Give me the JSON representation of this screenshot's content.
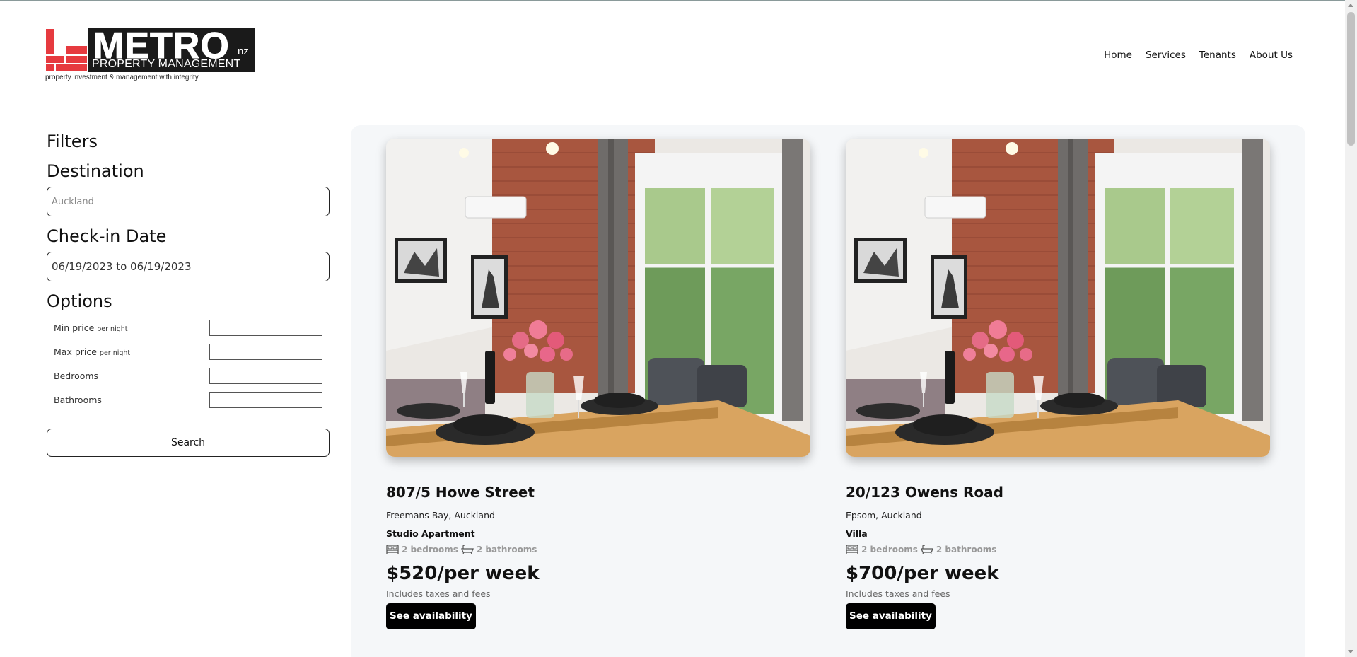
{
  "logo": {
    "brand": "METRO",
    "country": "nz",
    "subtitle": "PROPERTY MANAGEMENT",
    "tagline": "property investment & management with integrity",
    "accent_color": "#e63a3f"
  },
  "nav": {
    "items": [
      "Home",
      "Services",
      "Tenants",
      "About Us"
    ]
  },
  "filters": {
    "heading": "Filters",
    "destination_label": "Destination",
    "destination_placeholder": "Auckland",
    "checkin_label": "Check-in Date",
    "checkin_value": "06/19/2023 to 06/19/2023",
    "options_label": "Options",
    "options": [
      {
        "label": "Min price",
        "suffix": "per night"
      },
      {
        "label": "Max price",
        "suffix": "per night"
      },
      {
        "label": "Bedrooms",
        "suffix": ""
      },
      {
        "label": "Bathrooms",
        "suffix": ""
      }
    ],
    "search_label": "Search"
  },
  "listings": [
    {
      "title": "807/5 Howe Street",
      "location": "Freemans Bay, Auckland",
      "type": "Studio Apartment",
      "bedrooms": "2 bedrooms",
      "bathrooms": "2 bathrooms",
      "price": "$520/per week",
      "tax_note": "Includes taxes and fees",
      "cta": "See availability",
      "bed_icon": "bed-icon",
      "bath_icon": "bathtub-icon"
    },
    {
      "title": "20/123 Owens Road",
      "location": "Epsom, Auckland",
      "type": "Villa",
      "bedrooms": "2 bedrooms",
      "bathrooms": "2 bathrooms",
      "price": "$700/per week",
      "tax_note": "Includes taxes and fees",
      "cta": "See availability",
      "bed_icon": "bed-icon",
      "bath_icon": "bathtub-icon"
    }
  ]
}
